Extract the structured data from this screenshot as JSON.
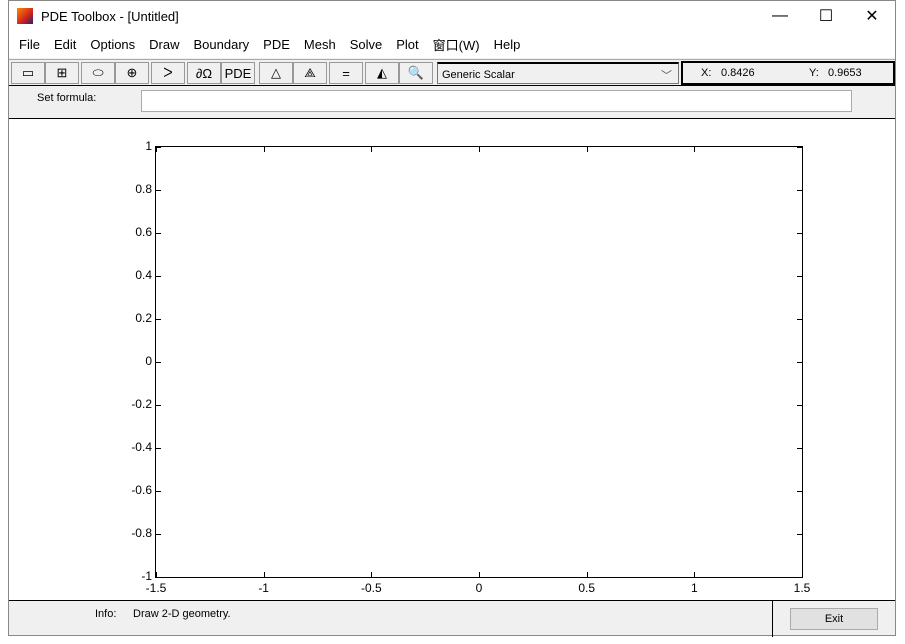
{
  "window": {
    "title": "PDE Toolbox - [Untitled]",
    "minimize": "—",
    "maximize": "☐",
    "close": "✕"
  },
  "menu": [
    "File",
    "Edit",
    "Options",
    "Draw",
    "Boundary",
    "PDE",
    "Mesh",
    "Solve",
    "Plot",
    "窗口(W)",
    "Help"
  ],
  "toolbar": {
    "buttons": [
      {
        "name": "rectangle-icon",
        "glyph": "▭"
      },
      {
        "name": "rectangle-center-icon",
        "glyph": "⊞"
      },
      {
        "name": "ellipse-icon",
        "glyph": "⬭"
      },
      {
        "name": "ellipse-center-icon",
        "glyph": "⊕"
      },
      {
        "name": "polygon-icon",
        "glyph": "ᐳ"
      },
      {
        "name": "boundary-mode-icon",
        "glyph": "∂Ω"
      },
      {
        "name": "pde-spec-button",
        "glyph": "PDE"
      },
      {
        "name": "mesh-init-icon",
        "glyph": "△"
      },
      {
        "name": "mesh-refine-icon",
        "glyph": "⟁"
      },
      {
        "name": "solve-icon",
        "glyph": "="
      },
      {
        "name": "plot-icon",
        "glyph": "◭"
      },
      {
        "name": "zoom-icon",
        "glyph": "🔍"
      }
    ],
    "application": "Generic Scalar",
    "x_label": "X:",
    "x_value": "0.8426",
    "y_label": "Y:",
    "y_value": "0.9653"
  },
  "formula": {
    "label": "Set formula:",
    "value": ""
  },
  "axes": {
    "xticks": [
      "-1.5",
      "-1",
      "-0.5",
      "0",
      "0.5",
      "1",
      "1.5"
    ],
    "yticks": [
      "1",
      "0.8",
      "0.6",
      "0.4",
      "0.2",
      "0",
      "-0.2",
      "-0.4",
      "-0.6",
      "-0.8",
      "-1"
    ]
  },
  "info": {
    "label": "Info:",
    "text": "Draw 2-D geometry.",
    "exit": "Exit"
  }
}
